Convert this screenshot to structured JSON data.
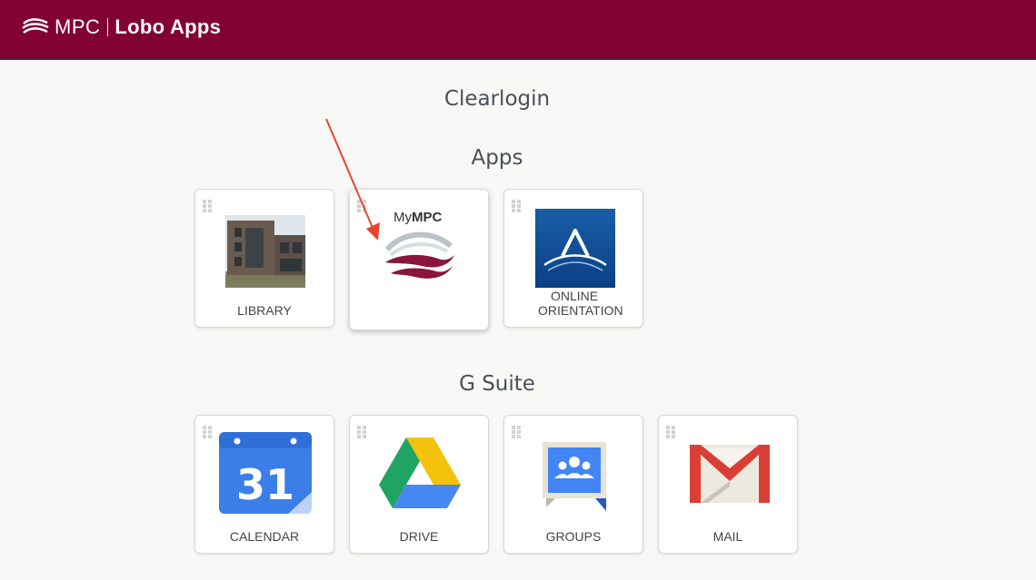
{
  "header": {
    "brand_mpc": "MPC",
    "brand_app": "Lobo Apps",
    "logo_icon": "mpc-wave-logo-icon",
    "background_color": "#830033"
  },
  "main": {
    "org_title": "Clearlogin",
    "sections": [
      {
        "title": "Apps",
        "tiles": [
          {
            "label": "LIBRARY",
            "icon": "library-building-icon"
          },
          {
            "label": "",
            "icon": "mympc-logo-icon",
            "logo_text_my": "My",
            "logo_text_mpc": "MPC"
          },
          {
            "label": "ONLINE ORIENTATION",
            "icon": "online-orientation-icon"
          }
        ]
      },
      {
        "title": "G Suite",
        "tiles": [
          {
            "label": "CALENDAR",
            "icon": "google-calendar-icon",
            "icon_text": "31"
          },
          {
            "label": "DRIVE",
            "icon": "google-drive-icon"
          },
          {
            "label": "GROUPS",
            "icon": "google-groups-icon"
          },
          {
            "label": "MAIL",
            "icon": "gmail-icon"
          }
        ]
      }
    ]
  },
  "annotation": {
    "type": "arrow",
    "color": "#e8452c"
  }
}
